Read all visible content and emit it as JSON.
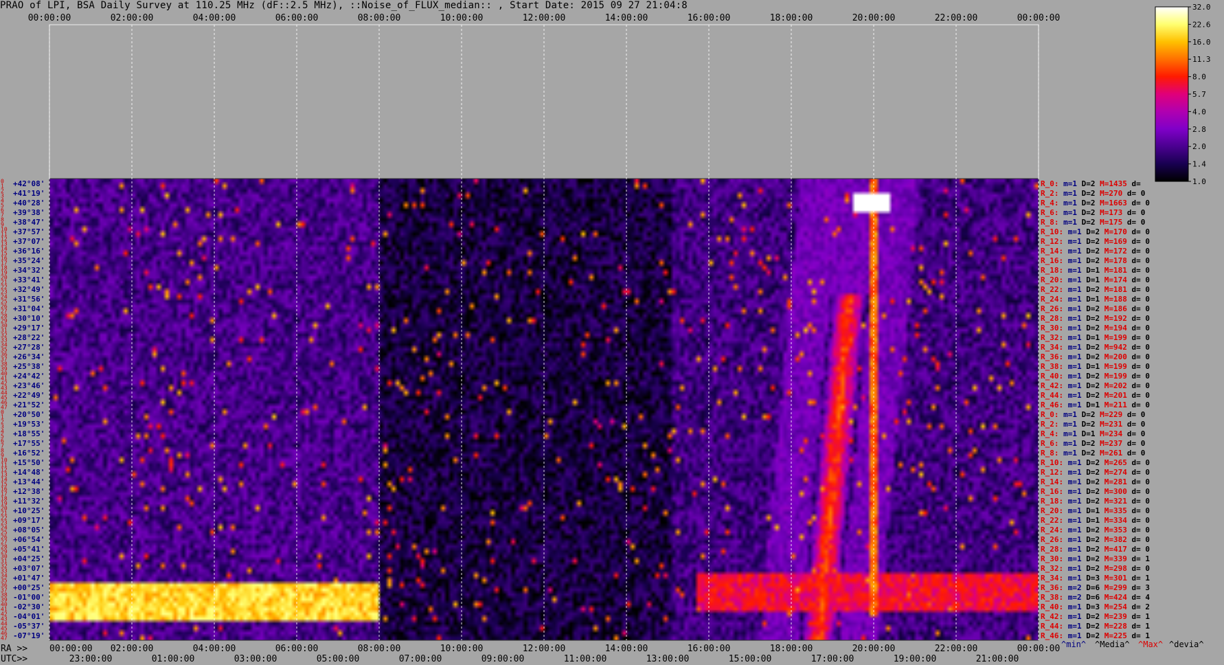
{
  "title": "PRAO of LPI, BSA Daily Survey at 110.25 MHz (dF::2.5 MHz), ::Noise_of_FLUX_median:: , Start Date: 2015 09 27 21:04:8",
  "colors": {
    "background": "#a6a6a6",
    "row_label": "#cc0000",
    "dec_label": "#000080",
    "stat_red": "#dd0000",
    "stat_blue": "#000080"
  },
  "bottom": {
    "ra_prefix": "RA >>",
    "utc_prefix": "UTC>>",
    "legend_min": "^min^",
    "legend_media": "^Media^",
    "legend_max": "^Max^",
    "legend_devia": "^devia^"
  },
  "chart_data": {
    "type": "heatmap",
    "title": "PRAO of LPI, BSA Daily Survey at 110.25 MHz (dF::2.5 MHz), ::Noise_of_FLUX_median:: , Start Date: 2015 09 27 21:04:8",
    "x_ticks_top": [
      "00:00:00",
      "02:00:00",
      "04:00:00",
      "06:00:00",
      "08:00:00",
      "10:00:00",
      "12:00:00",
      "14:00:00",
      "16:00:00",
      "18:00:00",
      "20:00:00",
      "22:00:00",
      "00:00:00"
    ],
    "x_ticks_ra": [
      "00:00:00",
      "02:00:00",
      "04:00:00",
      "06:00:00",
      "08:00:00",
      "10:00:00",
      "12:00:00",
      "14:00:00",
      "16:00:00",
      "18:00:00",
      "20:00:00",
      "22:00:00",
      "00:00:00"
    ],
    "x_ticks_utc": [
      "23:00:00",
      "01:00:00",
      "03:00:00",
      "05:00:00",
      "07:00:00",
      "09:00:00",
      "11:00:00",
      "13:00:00",
      "15:00:00",
      "17:00:00",
      "19:00:00",
      "21:00:00"
    ],
    "row_numbers": [
      "0",
      "1",
      "2",
      "3",
      "4",
      "5",
      "6",
      "7",
      "8",
      "9",
      "10",
      "11",
      "12",
      "13",
      "14",
      "15",
      "16",
      "17",
      "18",
      "19",
      "20",
      "21",
      "22",
      "23",
      "24",
      "25",
      "26",
      "27",
      "28",
      "29",
      "30",
      "31",
      "32",
      "33",
      "34",
      "35",
      "36",
      "37",
      "38",
      "39",
      "40",
      "41",
      "42",
      "43",
      "44",
      "45",
      "46",
      "47",
      "0",
      "1",
      "2",
      "3",
      "4",
      "5",
      "6",
      "7",
      "8",
      "9",
      "10",
      "11",
      "12",
      "13",
      "14",
      "15",
      "16",
      "17",
      "18",
      "19",
      "20",
      "21",
      "22",
      "23",
      "24",
      "25",
      "26",
      "27",
      "28",
      "29",
      "30",
      "31",
      "32",
      "33",
      "34",
      "35",
      "36",
      "37",
      "38",
      "39",
      "40",
      "41",
      "42",
      "43",
      "44",
      "45",
      "46",
      "47"
    ],
    "declinations": [
      "+42°08'",
      "+41°19'",
      "+40°28'",
      "+39°38'",
      "+38°47'",
      "+37°57'",
      "+37°07'",
      "+36°16'",
      "+35°24'",
      "+34°32'",
      "+33°41'",
      "+32°49'",
      "+31°56'",
      "+31°04'",
      "+30°10'",
      "+29°17'",
      "+28°22'",
      "+27°28'",
      "+26°34'",
      "+25°38'",
      "+24°42'",
      "+23°46'",
      "+22°49'",
      "+21°52'",
      "+20°50'",
      "+19°53'",
      "+18°55'",
      "+17°55'",
      "+16°52'",
      "+15°50'",
      "+14°48'",
      "+13°44'",
      "+12°38'",
      "+11°32'",
      "+10°25'",
      "+09°17'",
      "+08°05'",
      "+06°54'",
      "+05°41'",
      "+04°25'",
      "+03°07'",
      "+01°47'",
      "+00°25'",
      "-01°00'",
      "-02°30'",
      "-04°01'",
      "-05°37'",
      "-07°19'"
    ],
    "row_stats": [
      [
        "R_0:",
        "m=1",
        "D=2",
        "M=1435",
        "d="
      ],
      [
        "R_2:",
        "m=1",
        "D=2",
        "M=270",
        "d= 0"
      ],
      [
        "R_4:",
        "m=1",
        "D=2",
        "M=1663",
        "d= 0"
      ],
      [
        "R_6:",
        "m=1",
        "D=2",
        "M=173",
        "d= 0"
      ],
      [
        "R_8:",
        "m=1",
        "D=2",
        "M=175",
        "d= 0"
      ],
      [
        "R_10:",
        "m=1",
        "D=2",
        "M=170",
        "d= 0"
      ],
      [
        "R_12:",
        "m=1",
        "D=2",
        "M=169",
        "d= 0"
      ],
      [
        "R_14:",
        "m=1",
        "D=2",
        "M=172",
        "d= 0"
      ],
      [
        "R_16:",
        "m=1",
        "D=2",
        "M=178",
        "d= 0"
      ],
      [
        "R_18:",
        "m=1",
        "D=1",
        "M=181",
        "d= 0"
      ],
      [
        "R_20:",
        "m=1",
        "D=1",
        "M=174",
        "d= 0"
      ],
      [
        "R_22:",
        "m=1",
        "D=2",
        "M=181",
        "d= 0"
      ],
      [
        "R_24:",
        "m=1",
        "D=1",
        "M=188",
        "d= 0"
      ],
      [
        "R_26:",
        "m=1",
        "D=2",
        "M=186",
        "d= 0"
      ],
      [
        "R_28:",
        "m=1",
        "D=2",
        "M=192",
        "d= 0"
      ],
      [
        "R_30:",
        "m=1",
        "D=2",
        "M=194",
        "d= 0"
      ],
      [
        "R_32:",
        "m=1",
        "D=1",
        "M=199",
        "d= 0"
      ],
      [
        "R_34:",
        "m=1",
        "D=2",
        "M=942",
        "d= 0"
      ],
      [
        "R_36:",
        "m=1",
        "D=2",
        "M=200",
        "d= 0"
      ],
      [
        "R_38:",
        "m=1",
        "D=1",
        "M=199",
        "d= 0"
      ],
      [
        "R_40:",
        "m=1",
        "D=2",
        "M=199",
        "d= 0"
      ],
      [
        "R_42:",
        "m=1",
        "D=2",
        "M=202",
        "d= 0"
      ],
      [
        "R_44:",
        "m=1",
        "D=2",
        "M=201",
        "d= 0"
      ],
      [
        "R_46:",
        "m=1",
        "D=1",
        "M=211",
        "d= 0"
      ],
      [
        "R_0:",
        "m=1",
        "D=2",
        "M=229",
        "d= 0"
      ],
      [
        "R_2:",
        "m=1",
        "D=2",
        "M=231",
        "d= 0"
      ],
      [
        "R_4:",
        "m=1",
        "D=1",
        "M=234",
        "d= 0"
      ],
      [
        "R_6:",
        "m=1",
        "D=2",
        "M=237",
        "d= 0"
      ],
      [
        "R_8:",
        "m=1",
        "D=2",
        "M=261",
        "d= 0"
      ],
      [
        "R_10:",
        "m=1",
        "D=2",
        "M=265",
        "d= 0"
      ],
      [
        "R_12:",
        "m=1",
        "D=2",
        "M=274",
        "d= 0"
      ],
      [
        "R_14:",
        "m=1",
        "D=2",
        "M=281",
        "d= 0"
      ],
      [
        "R_16:",
        "m=1",
        "D=2",
        "M=300",
        "d= 0"
      ],
      [
        "R_18:",
        "m=1",
        "D=2",
        "M=321",
        "d= 0"
      ],
      [
        "R_20:",
        "m=1",
        "D=1",
        "M=335",
        "d= 0"
      ],
      [
        "R_22:",
        "m=1",
        "D=1",
        "M=334",
        "d= 0"
      ],
      [
        "R_24:",
        "m=1",
        "D=2",
        "M=353",
        "d= 0"
      ],
      [
        "R_26:",
        "m=1",
        "D=2",
        "M=382",
        "d= 0"
      ],
      [
        "R_28:",
        "m=1",
        "D=2",
        "M=417",
        "d= 0"
      ],
      [
        "R_30:",
        "m=1",
        "D=2",
        "M=339",
        "d= 1"
      ],
      [
        "R_32:",
        "m=1",
        "D=2",
        "M=298",
        "d= 0"
      ],
      [
        "R_34:",
        "m=1",
        "D=3",
        "M=301",
        "d= 1"
      ],
      [
        "R_36:",
        "m=2",
        "D=6",
        "M=299",
        "d= 3"
      ],
      [
        "R_38:",
        "m=2",
        "D=6",
        "M=424",
        "d= 4"
      ],
      [
        "R_40:",
        "m=1",
        "D=3",
        "M=254",
        "d= 2"
      ],
      [
        "R_42:",
        "m=1",
        "D=2",
        "M=239",
        "d= 1"
      ],
      [
        "R_44:",
        "m=1",
        "D=2",
        "M=228",
        "d= 1"
      ],
      [
        "R_46:",
        "m=1",
        "D=2",
        "M=225",
        "d= 1"
      ]
    ],
    "colorbar_ticks": [
      "32.0",
      "22.6",
      "16.0",
      "11.3",
      "8.0",
      "5.7",
      "4.0",
      "2.8",
      "2.0",
      "1.4",
      "1.0"
    ],
    "colorbar_range": [
      1.0,
      32.0
    ],
    "colorbar_scale": "log",
    "colormap": [
      "#000000",
      "#180050",
      "#4a0090",
      "#8000c8",
      "#b000b0",
      "#e0007a",
      "#ff1a00",
      "#ff7000",
      "#ffc000",
      "#ffff70",
      "#ffffff"
    ],
    "features": [
      {
        "type": "band",
        "dec_from": "+00°25'",
        "dec_to": "-04°01'",
        "ra_from": "00:00:00",
        "ra_to": "08:00:00",
        "level": 22
      },
      {
        "type": "band",
        "dec_from": "+01°47'",
        "dec_to": "-02°30'",
        "ra_from": "15:40:00",
        "ra_to": "00:00:00",
        "level": 8
      },
      {
        "type": "drift",
        "ra_from": "18:40:00",
        "ra_to": "19:40:00",
        "level": 10
      },
      {
        "type": "source",
        "ra": "19:58:00",
        "dec": "+40°28'",
        "level": 32
      }
    ]
  }
}
